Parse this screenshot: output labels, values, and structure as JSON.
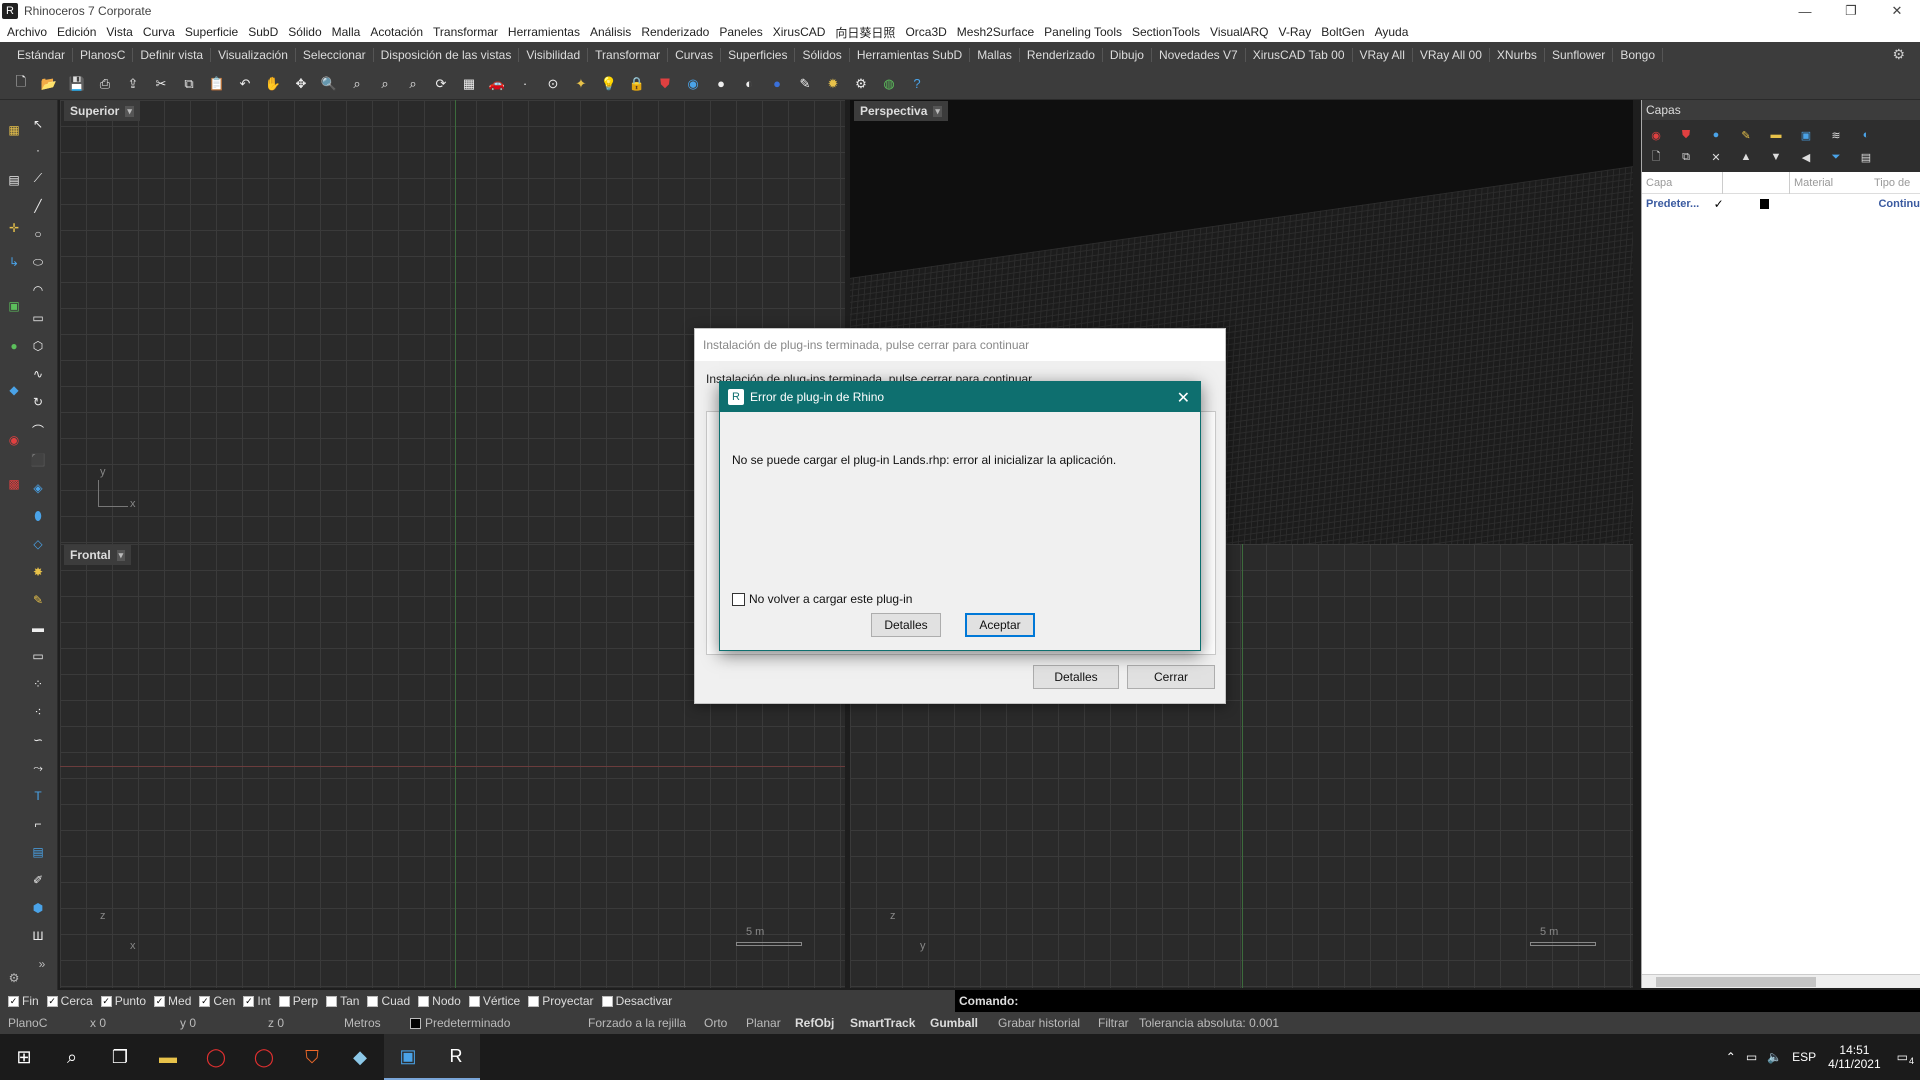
{
  "window": {
    "title": "Rhinoceros 7 Corporate",
    "minimize": "—",
    "maximize": "❐",
    "close": "✕"
  },
  "menu": [
    "Archivo",
    "Edición",
    "Vista",
    "Curva",
    "Superficie",
    "SubD",
    "Sólido",
    "Malla",
    "Acotación",
    "Transformar",
    "Herramientas",
    "Análisis",
    "Renderizado",
    "Paneles",
    "XirusCAD",
    "向日葵日照",
    "Orca3D",
    "Mesh2Surface",
    "Paneling Tools",
    "SectionTools",
    "VisualARQ",
    "V-Ray",
    "BoltGen",
    "Ayuda"
  ],
  "tabs": [
    "Estándar",
    "PlanosC",
    "Definir vista",
    "Visualización",
    "Seleccionar",
    "Disposición de las vistas",
    "Visibilidad",
    "Transformar",
    "Curvas",
    "Superficies",
    "Sólidos",
    "Herramientas SubD",
    "Mallas",
    "Renderizado",
    "Dibujo",
    "Novedades V7",
    "XirusCAD Tab 00",
    "VRay All",
    "VRay All 00",
    "XNurbs",
    "Sunflower",
    "Bongo"
  ],
  "viewports": {
    "top": {
      "label": "Superior",
      "axis_x": "x",
      "axis_y": "y"
    },
    "perspective": {
      "label": "Perspectiva"
    },
    "front": {
      "label": "Frontal",
      "axis_x": "x",
      "axis_z": "z",
      "scale": "5 m"
    },
    "right": {
      "axis_y": "y",
      "axis_z": "z",
      "scale": "5 m"
    }
  },
  "layers_panel": {
    "title": "Capas",
    "columns": {
      "layer": "Capa",
      "material": "Material",
      "linetype": "Tipo de"
    },
    "rows": [
      {
        "name": "Predeter...",
        "current": "✓",
        "linetype": "Continu"
      }
    ]
  },
  "osnaps": [
    {
      "label": "Fin",
      "checked": true
    },
    {
      "label": "Cerca",
      "checked": true
    },
    {
      "label": "Punto",
      "checked": true
    },
    {
      "label": "Med",
      "checked": true
    },
    {
      "label": "Cen",
      "checked": true
    },
    {
      "label": "Int",
      "checked": true
    },
    {
      "label": "Perp",
      "checked": false
    },
    {
      "label": "Tan",
      "checked": false
    },
    {
      "label": "Cuad",
      "checked": false
    },
    {
      "label": "Nodo",
      "checked": false
    },
    {
      "label": "Vértice",
      "checked": false
    },
    {
      "label": "Proyectar",
      "checked": false
    },
    {
      "label": "Desactivar",
      "checked": false
    }
  ],
  "command": {
    "prompt": "Comando:"
  },
  "status": {
    "cplane": "PlanoC",
    "x": "x 0",
    "y": "y 0",
    "z": "z 0",
    "units": "Metros",
    "layer": "Predeterminado",
    "grid_snap": "Forzado a la rejilla",
    "ortho": "Orto",
    "planar": "Planar",
    "osnap": "RefObj",
    "smarttrack": "SmartTrack",
    "gumball": "Gumball",
    "history": "Grabar historial",
    "filter": "Filtrar",
    "tolerance": "Tolerancia absoluta: 0.001"
  },
  "install_dialog": {
    "title": "Instalación de plug-ins terminada, pulse cerrar para continuar",
    "subtitle": "Instalación de plug-ins terminada, pulse cerrar para continuar",
    "details": "Detalles",
    "close": "Cerrar"
  },
  "error_dialog": {
    "title": "Error de plug-in de Rhino",
    "message": "No se puede cargar el plug-in Lands.rhp: error al inicializar la aplicación.",
    "checkbox": "No volver a cargar este plug-in",
    "details": "Detalles",
    "accept": "Aceptar"
  },
  "taskbar": {
    "lang": "ESP",
    "time": "14:51",
    "date": "4/11/2021",
    "notifications": "4"
  },
  "colors": {
    "dialog_title": "#0e6f6f",
    "accent": "#0078d7",
    "chrome": "#3c3c3c"
  }
}
